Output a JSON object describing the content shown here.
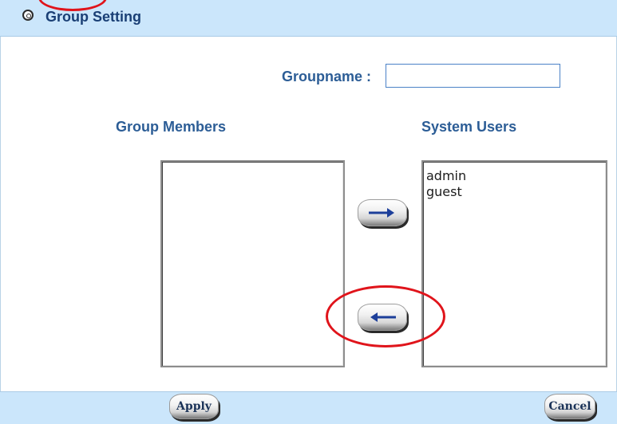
{
  "header": {
    "title": "Group Setting",
    "icon": "settings-circle-icon"
  },
  "form": {
    "groupname_label": "Groupname :",
    "groupname_value": ""
  },
  "members": {
    "label": "Group Members",
    "items": []
  },
  "users": {
    "label": "System Users",
    "items": [
      "admin",
      "guest"
    ]
  },
  "buttons": {
    "add_icon": "arrow-right-icon",
    "remove_icon": "arrow-left-icon",
    "apply_label": "Apply",
    "cancel_label": "Cancel"
  },
  "colors": {
    "header_bg": "#cbe6fb",
    "label_blue": "#2c5d96",
    "arrow_blue": "#1d3f9a",
    "annotation_red": "#e0141b"
  }
}
